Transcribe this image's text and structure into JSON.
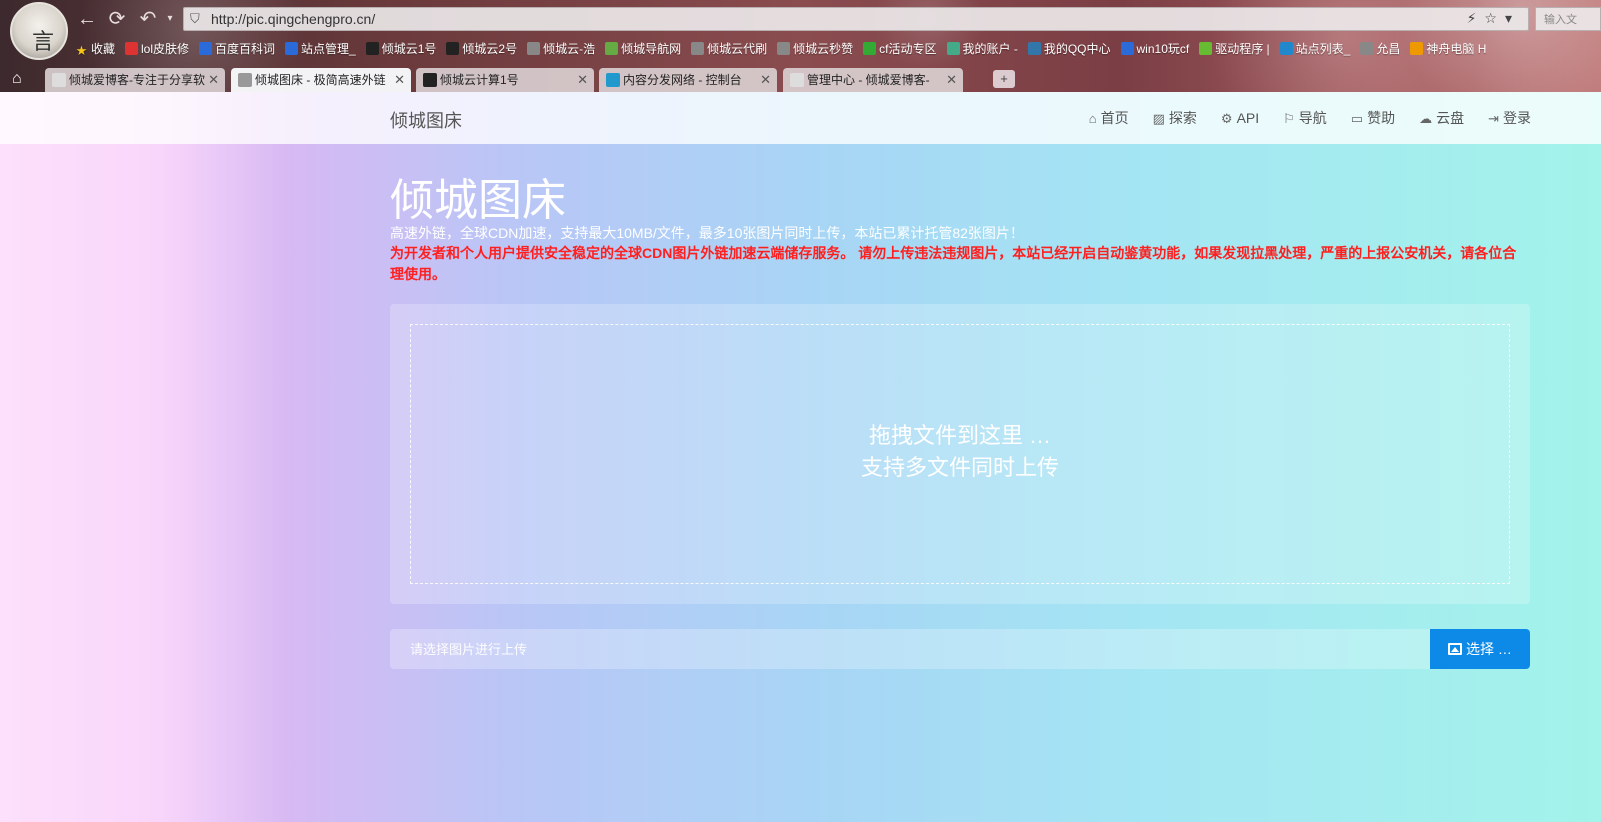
{
  "browser": {
    "url": "http://pic.qingchengpro.cn/",
    "search_placeholder": "输入文",
    "avatar_glyph": "言",
    "bookmarks": [
      {
        "label": "收藏",
        "icon": "star-icon",
        "color": "#f5c518"
      },
      {
        "label": "lol皮肤修",
        "icon": "circle-icon",
        "color": "#d33"
      },
      {
        "label": "百度百科词",
        "icon": "baidu-paw-icon",
        "color": "#2a6ad9"
      },
      {
        "label": "站点管理_",
        "icon": "baidu-paw-icon",
        "color": "#2a6ad9"
      },
      {
        "label": "倾城云1号",
        "icon": "bt-icon",
        "color": "#222"
      },
      {
        "label": "倾城云2号",
        "icon": "bt-icon",
        "color": "#222"
      },
      {
        "label": "倾城云-浩",
        "icon": "page-icon",
        "color": "#888"
      },
      {
        "label": "倾城导航网",
        "icon": "pen-icon",
        "color": "#6a4"
      },
      {
        "label": "倾城云代刷",
        "icon": "page-icon",
        "color": "#888"
      },
      {
        "label": "倾城云秒赞",
        "icon": "page-icon",
        "color": "#888"
      },
      {
        "label": "cf活动专区",
        "icon": "six-icon",
        "color": "#3a3"
      },
      {
        "label": "我的账户 -",
        "icon": "globe-icon",
        "color": "#4a8"
      },
      {
        "label": "我的QQ中心",
        "icon": "globe-icon",
        "color": "#37a"
      },
      {
        "label": "win10玩cf",
        "icon": "baidu-paw-icon",
        "color": "#2a6ad9"
      },
      {
        "label": "驱动程序 |",
        "icon": "nvidia-icon",
        "color": "#6b3"
      },
      {
        "label": "站点列表_",
        "icon": "flag-icon",
        "color": "#28c"
      },
      {
        "label": "允昌",
        "icon": "page-icon",
        "color": "#888"
      },
      {
        "label": "神舟电脑 H",
        "icon": "hasee-icon",
        "color": "#e90"
      }
    ],
    "tabs": [
      {
        "label": "倾城爱博客-专注于分享软",
        "icon_color": "#ddd",
        "active": false
      },
      {
        "label": "倾城图床 - 极简高速外链",
        "icon_color": "#999",
        "active": true
      },
      {
        "label": "倾城云计算1号",
        "icon_color": "#222",
        "active": false
      },
      {
        "label": "内容分发网络 - 控制台",
        "icon_color": "#29c",
        "active": false
      },
      {
        "label": "管理中心 - 倾城爱博客-",
        "icon_color": "#ddd",
        "active": false
      }
    ],
    "tab_add_label": "+"
  },
  "site": {
    "brand": "倾城图床",
    "menu": [
      {
        "label": "首页",
        "icon": "home-icon",
        "glyph": "⌂"
      },
      {
        "label": "探索",
        "icon": "image-icon",
        "glyph": "▨"
      },
      {
        "label": "API",
        "icon": "gear-icon",
        "glyph": "⚙"
      },
      {
        "label": "导航",
        "icon": "signpost-icon",
        "glyph": "⚐"
      },
      {
        "label": "赞助",
        "icon": "wallet-icon",
        "glyph": "▭"
      },
      {
        "label": "云盘",
        "icon": "cloud-download-icon",
        "glyph": "☁"
      },
      {
        "label": "登录",
        "icon": "sign-in-icon",
        "glyph": "⇥"
      }
    ]
  },
  "hero": {
    "title": "倾城图床",
    "subtitle": "高速外链，全球CDN加速，支持最大10MB/文件，最多10张图片同时上传，本站已累计托管82张图片！",
    "warning": "为开发者和个人用户提供安全稳定的全球CDN图片外链加速云端储存服务。 请勿上传违法违规图片，本站已经开启自动鉴黄功能，如果发现拉黑处理，严重的上报公安机关，请各位合理使用。"
  },
  "dropzone": {
    "line1": "拖拽文件到这里 …",
    "line2": "支持多文件同时上传"
  },
  "upload": {
    "placeholder": "请选择图片进行上传",
    "button_label": "选择 …"
  },
  "colors": {
    "warning_text": "#ff1f1f",
    "button_primary": "#0d8ae8"
  }
}
